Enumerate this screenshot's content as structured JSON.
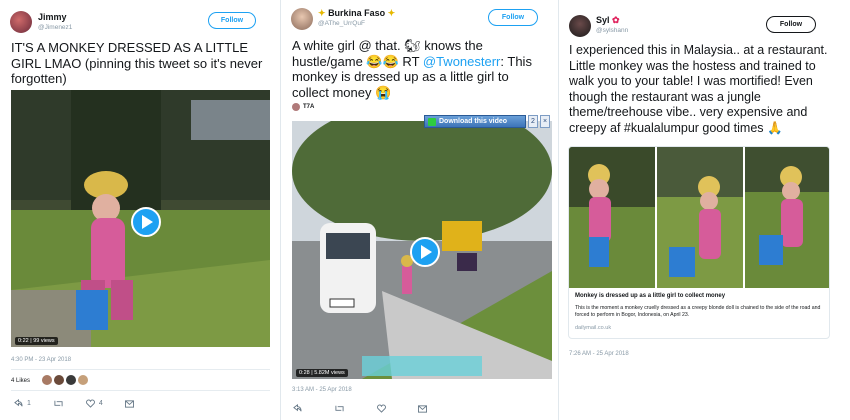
{
  "tweets": [
    {
      "name": "Jimmy",
      "handle": "@Jimenez1",
      "follow_label": "Follow",
      "text": "IT'S A MONKEY DRESSED AS A LITTLE GIRL LMAO (pinning this tweet so it's never forgotten)",
      "video_time": "0:22",
      "video_views": "99 views",
      "timestamp": "4:30 PM - 23 Apr 2018",
      "likes": "4 Likes",
      "reply_count": "1",
      "like_count": "4"
    },
    {
      "name": "Burkina Faso",
      "handle": "@AThe_UrrQuF",
      "follow_label": "Follow",
      "text_before": "A white girl @ that. 🐿 knows the hustle/game 😂😂 RT ",
      "mention": "@Twonesterr",
      "text_after": ": This monkey is dressed up as a little girl to collect money 😭",
      "sub_author": "T7A",
      "download_label": "Download this video",
      "download_extra": "2",
      "video_time": "0:28",
      "video_views": "5.82M views",
      "timestamp": "3:13 AM - 25 Apr 2018"
    },
    {
      "name": "Syl",
      "handle": "@sylshann",
      "follow_label": "Follow",
      "text": "I experienced this in Malaysia.. at a restaurant. Little monkey was the hostess and trained to walk you to your table! I was mortified! Even though the restaurant was a jungle theme/treehouse vibe.. very expensive and creepy af #kualalumpur good times 🙏",
      "card_title": "Monkey is dressed up as a little girl to collect money",
      "card_desc": "This is the moment a monkey cruelly dressed as a creepy blonde doll is chained to the side of the road and forced to perform in Bogor, Indonesia, on April 23.",
      "card_domain": "dailymail.co.uk",
      "timestamp": "7:26 AM - 25 Apr 2018"
    }
  ],
  "icons": [
    "reply-icon",
    "retweet-icon",
    "like-icon",
    "dm-icon",
    "play-icon",
    "download-icon"
  ],
  "colors": {
    "twitter_blue": "#1da1f2",
    "meta_gray": "#8899a6"
  }
}
